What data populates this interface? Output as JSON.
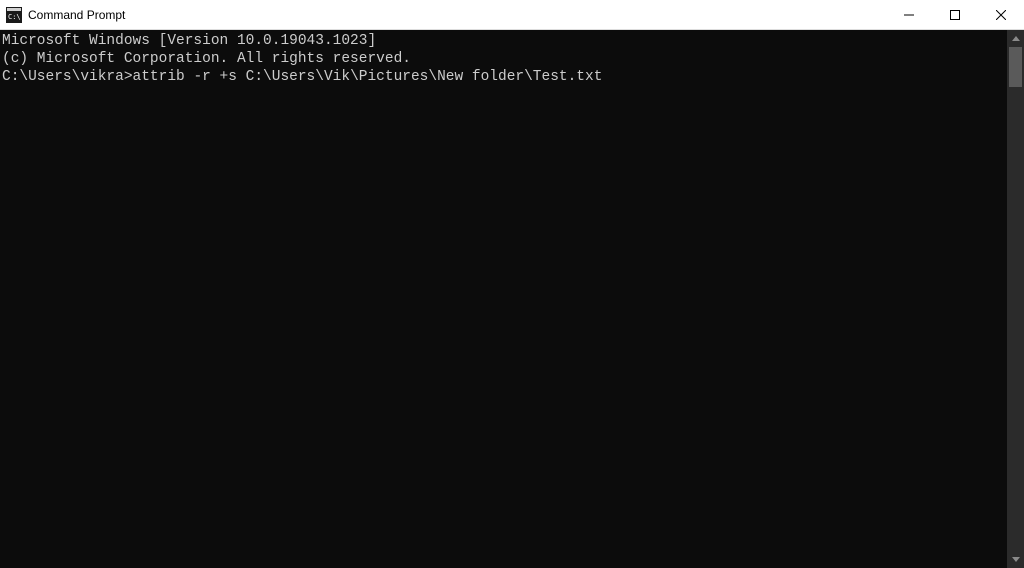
{
  "titlebar": {
    "title": "Command Prompt"
  },
  "terminal": {
    "line1": "Microsoft Windows [Version 10.0.19043.1023]",
    "line2": "(c) Microsoft Corporation. All rights reserved.",
    "blank": "",
    "prompt": "C:\\Users\\vikra>",
    "command": "attrib -r +s C:\\Users\\Vik\\Pictures\\New folder\\Test.txt"
  }
}
